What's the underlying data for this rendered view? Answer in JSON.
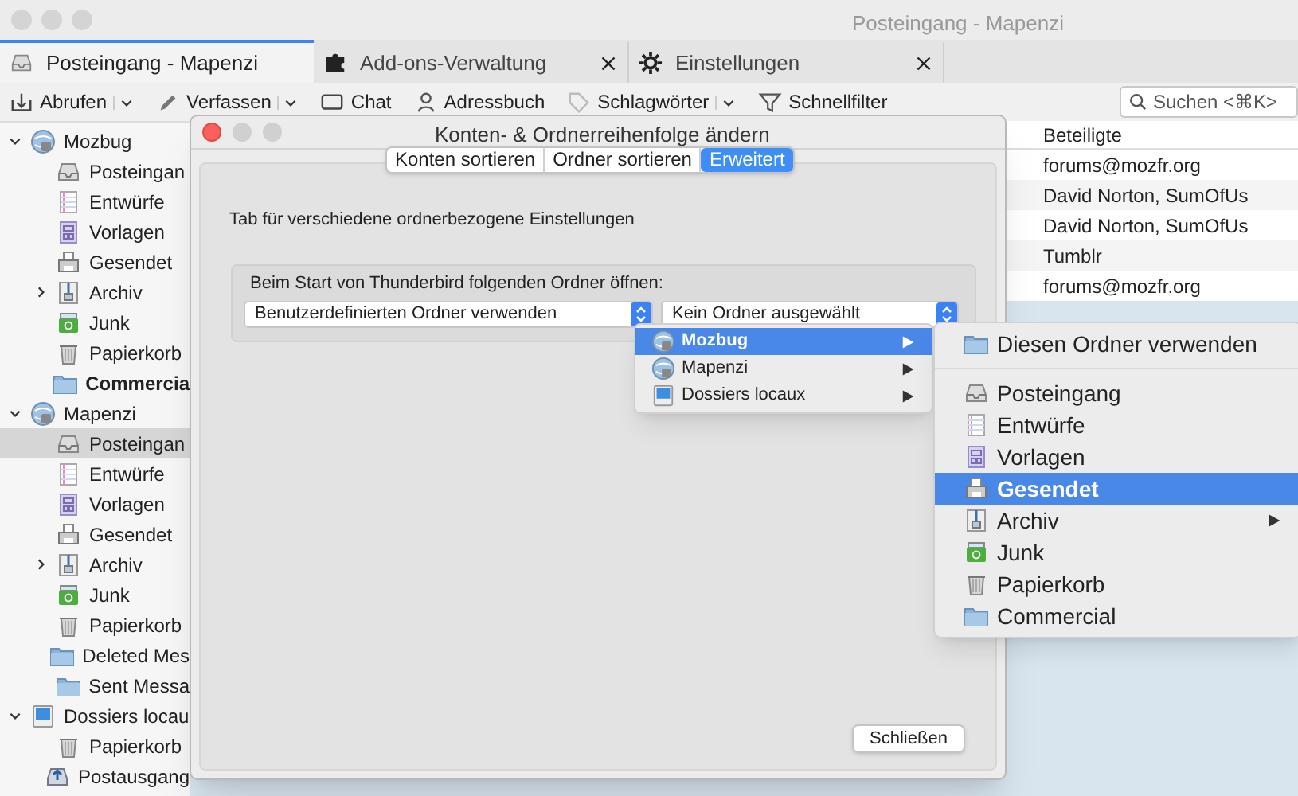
{
  "window": {
    "title": "Posteingang - Mapenzi"
  },
  "tabs": [
    {
      "label": "Posteingang - Mapenzi",
      "kind": "inbox",
      "selected": true,
      "closable": false
    },
    {
      "label": "Add-ons-Verwaltung",
      "kind": "puzzle",
      "selected": false,
      "closable": true
    },
    {
      "label": "Einstellungen",
      "kind": "gear",
      "selected": false,
      "closable": true
    }
  ],
  "toolbar": [
    {
      "label": "Abrufen",
      "kind": "download",
      "dropdown": true
    },
    {
      "label": "Verfassen",
      "kind": "pencil",
      "dropdown": true
    },
    {
      "label": "Chat",
      "kind": "chat",
      "dropdown": false
    },
    {
      "label": "Adressbuch",
      "kind": "person",
      "dropdown": false
    },
    {
      "label": "Schlagwörter",
      "kind": "tag",
      "dropdown": true
    },
    {
      "label": "Schnellfilter",
      "kind": "filter",
      "dropdown": false
    }
  ],
  "search": {
    "placeholder": "Suchen <⌘K>"
  },
  "folders": [
    {
      "label": "Mozbug",
      "kind": "server",
      "expanded": true,
      "selected": false,
      "children": [
        {
          "label": "Posteingan",
          "kind": "inbox",
          "selected": false
        },
        {
          "label": "Entwürfe",
          "kind": "drafts",
          "selected": false
        },
        {
          "label": "Vorlagen",
          "kind": "templates",
          "selected": false
        },
        {
          "label": "Gesendet",
          "kind": "sent",
          "selected": false
        },
        {
          "label": "Archiv",
          "kind": "archive",
          "selected": false,
          "expanded": false
        },
        {
          "label": "Junk",
          "kind": "junk",
          "selected": false
        },
        {
          "label": "Papierkorb",
          "kind": "trash",
          "selected": false
        },
        {
          "label": "Commercia",
          "kind": "folder",
          "selected": false,
          "unread": true
        }
      ]
    },
    {
      "label": "Mapenzi",
      "kind": "server",
      "expanded": true,
      "selected": false,
      "children": [
        {
          "label": "Posteingan",
          "kind": "inbox",
          "selected": true
        },
        {
          "label": "Entwürfe",
          "kind": "drafts",
          "selected": false
        },
        {
          "label": "Vorlagen",
          "kind": "templates",
          "selected": false
        },
        {
          "label": "Gesendet",
          "kind": "sent",
          "selected": false
        },
        {
          "label": "Archiv",
          "kind": "archive",
          "selected": false,
          "expanded": false
        },
        {
          "label": "Junk",
          "kind": "junk",
          "selected": false
        },
        {
          "label": "Papierkorb",
          "kind": "trash",
          "selected": false
        },
        {
          "label": "Deleted Mes",
          "kind": "folder",
          "selected": false
        },
        {
          "label": "Sent Messa",
          "kind": "folder",
          "selected": false
        }
      ]
    },
    {
      "label": "Dossiers locau",
      "kind": "local",
      "expanded": true,
      "selected": false,
      "children": [
        {
          "label": "Papierkorb",
          "kind": "trash",
          "selected": false
        },
        {
          "label": "Postausgang",
          "kind": "outbox",
          "selected": false
        }
      ]
    }
  ],
  "messages": {
    "column": "Beteiligte",
    "rows": [
      "forums@mozfr.org",
      "David Norton, SumOfUs",
      "David Norton, SumOfUs",
      "Tumblr",
      "forums@mozfr.org"
    ]
  },
  "dialog": {
    "title": "Konten- & Ordnerreihenfolge ändern",
    "tabs": [
      {
        "label": "Konten sortieren",
        "selected": false
      },
      {
        "label": "Ordner sortieren",
        "selected": false
      },
      {
        "label": "Erweitert",
        "selected": true
      }
    ],
    "description": "Tab für verschiedene ordnerbezogene Einstellungen",
    "group_label": "Beim Start von Thunderbird folgenden Ordner öffnen:",
    "popups": [
      "Benutzerdefinierten Ordner verwenden",
      "Kein Ordner ausgewählt"
    ],
    "close_button": "Schließen"
  },
  "account_menu": [
    {
      "label": "Mozbug",
      "kind": "server",
      "selected": true
    },
    {
      "label": "Mapenzi",
      "kind": "server",
      "selected": false
    },
    {
      "label": "Dossiers locaux",
      "kind": "local",
      "selected": false
    }
  ],
  "folder_menu": {
    "action": {
      "label": "Diesen Ordner verwenden",
      "kind": "folder"
    },
    "folders": [
      {
        "label": "Posteingang",
        "kind": "inbox",
        "selected": false
      },
      {
        "label": "Entwürfe",
        "kind": "drafts",
        "selected": false
      },
      {
        "label": "Vorlagen",
        "kind": "templates",
        "selected": false
      },
      {
        "label": "Gesendet",
        "kind": "sent",
        "selected": true
      },
      {
        "label": "Archiv",
        "kind": "archive",
        "selected": false,
        "submenu": true
      },
      {
        "label": "Junk",
        "kind": "junk",
        "selected": false
      },
      {
        "label": "Papierkorb",
        "kind": "trash",
        "selected": false
      },
      {
        "label": "Commercial",
        "kind": "folder",
        "selected": false
      }
    ]
  }
}
